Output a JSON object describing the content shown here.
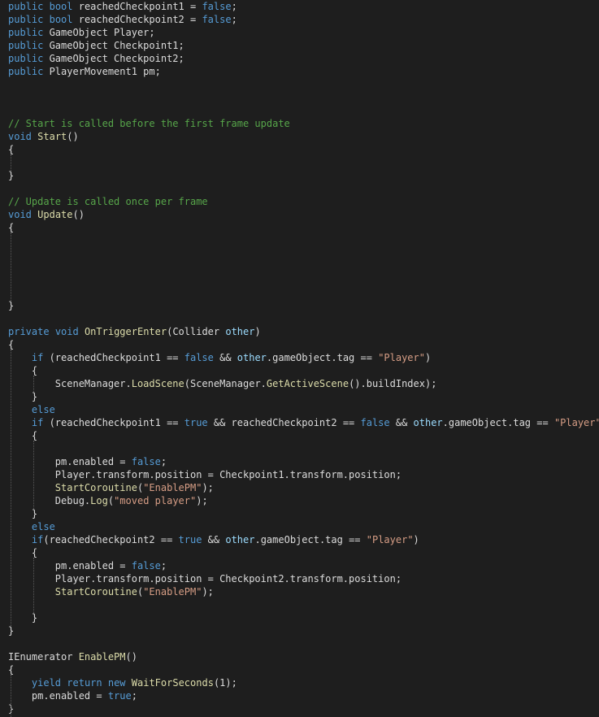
{
  "lines": [
    [
      [
        "kw",
        "public"
      ],
      [
        "tx",
        " "
      ],
      [
        "kw",
        "bool"
      ],
      [
        "tx",
        " reachedCheckpoint1 = "
      ],
      [
        "kw",
        "false"
      ],
      [
        "tx",
        ";"
      ]
    ],
    [
      [
        "kw",
        "public"
      ],
      [
        "tx",
        " "
      ],
      [
        "kw",
        "bool"
      ],
      [
        "tx",
        " reachedCheckpoint2 = "
      ],
      [
        "kw",
        "false"
      ],
      [
        "tx",
        ";"
      ]
    ],
    [
      [
        "kw",
        "public"
      ],
      [
        "tx",
        " GameObject Player;"
      ]
    ],
    [
      [
        "kw",
        "public"
      ],
      [
        "tx",
        " GameObject Checkpoint1;"
      ]
    ],
    [
      [
        "kw",
        "public"
      ],
      [
        "tx",
        " GameObject Checkpoint2;"
      ]
    ],
    [
      [
        "kw",
        "public"
      ],
      [
        "tx",
        " PlayerMovement1 pm;"
      ]
    ],
    [],
    [],
    [],
    [
      [
        "cm",
        "// Start is called before the first frame update"
      ]
    ],
    [
      [
        "kw",
        "void"
      ],
      [
        "tx",
        " "
      ],
      [
        "fn",
        "Start"
      ],
      [
        "tx",
        "()"
      ]
    ],
    [
      [
        "tx",
        "{"
      ]
    ],
    [],
    [
      [
        "tx",
        "}"
      ]
    ],
    [],
    [
      [
        "cm",
        "// Update is called once per frame"
      ]
    ],
    [
      [
        "kw",
        "void"
      ],
      [
        "tx",
        " "
      ],
      [
        "fn",
        "Update"
      ],
      [
        "tx",
        "()"
      ]
    ],
    [
      [
        "tx",
        "{"
      ]
    ],
    [],
    [],
    [],
    [],
    [],
    [
      [
        "tx",
        "}"
      ]
    ],
    [],
    [
      [
        "kw",
        "private"
      ],
      [
        "tx",
        " "
      ],
      [
        "kw",
        "void"
      ],
      [
        "tx",
        " "
      ],
      [
        "fn",
        "OnTriggerEnter"
      ],
      [
        "tx",
        "(Collider "
      ],
      [
        "pm",
        "other"
      ],
      [
        "tx",
        ")"
      ]
    ],
    [
      [
        "tx",
        "{"
      ]
    ],
    [
      [
        "tx",
        "    "
      ],
      [
        "kw",
        "if"
      ],
      [
        "tx",
        " (reachedCheckpoint1 == "
      ],
      [
        "kw",
        "false"
      ],
      [
        "tx",
        " && "
      ],
      [
        "pm",
        "other"
      ],
      [
        "tx",
        ".gameObject.tag == "
      ],
      [
        "st",
        "\"Player\""
      ],
      [
        "tx",
        ")"
      ]
    ],
    [
      [
        "tx",
        "    {"
      ]
    ],
    [
      [
        "tx",
        "        SceneManager."
      ],
      [
        "fn",
        "LoadScene"
      ],
      [
        "tx",
        "(SceneManager."
      ],
      [
        "fn",
        "GetActiveScene"
      ],
      [
        "tx",
        "().buildIndex);"
      ]
    ],
    [
      [
        "tx",
        "    }"
      ]
    ],
    [
      [
        "tx",
        "    "
      ],
      [
        "kw",
        "else"
      ]
    ],
    [
      [
        "tx",
        "    "
      ],
      [
        "kw",
        "if"
      ],
      [
        "tx",
        " (reachedCheckpoint1 == "
      ],
      [
        "kw",
        "true"
      ],
      [
        "tx",
        " && reachedCheckpoint2 == "
      ],
      [
        "kw",
        "false"
      ],
      [
        "tx",
        " && "
      ],
      [
        "pm",
        "other"
      ],
      [
        "tx",
        ".gameObject.tag == "
      ],
      [
        "st",
        "\"Player\""
      ],
      [
        "tx",
        ")"
      ]
    ],
    [
      [
        "tx",
        "    {"
      ]
    ],
    [],
    [
      [
        "tx",
        "        pm.enabled = "
      ],
      [
        "kw",
        "false"
      ],
      [
        "tx",
        ";"
      ]
    ],
    [
      [
        "tx",
        "        Player.transform.position = Checkpoint1.transform.position;"
      ]
    ],
    [
      [
        "tx",
        "        "
      ],
      [
        "fn",
        "StartCoroutine"
      ],
      [
        "tx",
        "("
      ],
      [
        "st",
        "\"EnablePM\""
      ],
      [
        "tx",
        ");"
      ]
    ],
    [
      [
        "tx",
        "        Debug."
      ],
      [
        "fn",
        "Log"
      ],
      [
        "tx",
        "("
      ],
      [
        "st",
        "\"moved player\""
      ],
      [
        "tx",
        ");"
      ]
    ],
    [
      [
        "tx",
        "    }"
      ]
    ],
    [
      [
        "tx",
        "    "
      ],
      [
        "kw",
        "else"
      ]
    ],
    [
      [
        "tx",
        "    "
      ],
      [
        "kw",
        "if"
      ],
      [
        "tx",
        "(reachedCheckpoint2 == "
      ],
      [
        "kw",
        "true"
      ],
      [
        "tx",
        " && "
      ],
      [
        "pm",
        "other"
      ],
      [
        "tx",
        ".gameObject.tag == "
      ],
      [
        "st",
        "\"Player\""
      ],
      [
        "tx",
        ")"
      ]
    ],
    [
      [
        "tx",
        "    {"
      ]
    ],
    [
      [
        "tx",
        "        pm.enabled = "
      ],
      [
        "kw",
        "false"
      ],
      [
        "tx",
        ";"
      ]
    ],
    [
      [
        "tx",
        "        Player.transform.position = Checkpoint2.transform.position;"
      ]
    ],
    [
      [
        "tx",
        "        "
      ],
      [
        "fn",
        "StartCoroutine"
      ],
      [
        "tx",
        "("
      ],
      [
        "st",
        "\"EnablePM\""
      ],
      [
        "tx",
        ");"
      ]
    ],
    [],
    [
      [
        "tx",
        "    }"
      ]
    ],
    [
      [
        "tx",
        "}"
      ]
    ],
    [],
    [
      [
        "tx",
        "IEnumerator "
      ],
      [
        "fn",
        "EnablePM"
      ],
      [
        "tx",
        "()"
      ]
    ],
    [
      [
        "tx",
        "{"
      ]
    ],
    [
      [
        "tx",
        "    "
      ],
      [
        "kw",
        "yield"
      ],
      [
        "tx",
        " "
      ],
      [
        "kw",
        "return"
      ],
      [
        "tx",
        " "
      ],
      [
        "kw",
        "new"
      ],
      [
        "tx",
        " "
      ],
      [
        "fn",
        "WaitForSeconds"
      ],
      [
        "tx",
        "(1);"
      ]
    ],
    [
      [
        "tx",
        "    pm.enabled = "
      ],
      [
        "kw",
        "true"
      ],
      [
        "tx",
        ";"
      ]
    ],
    [
      [
        "tx",
        "}"
      ]
    ]
  ],
  "colors": {
    "background": "#1e1e1e",
    "keyword": "#569cd6",
    "comment": "#57a64a",
    "string": "#d69d85",
    "method": "#dcdcaa",
    "parameter": "#9cdcfe",
    "text": "#dcdcdc"
  }
}
